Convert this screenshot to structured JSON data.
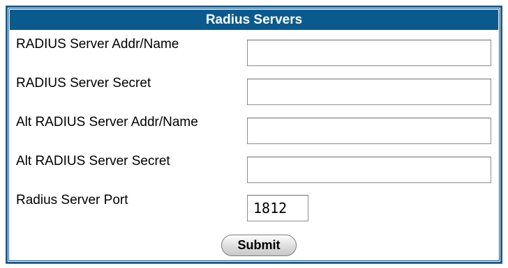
{
  "panel": {
    "title": "Radius Servers",
    "header_color": "#0b5a8e",
    "border_color": "#1f5c8c"
  },
  "form": {
    "fields": [
      {
        "label": "RADIUS Server Addr/Name",
        "value": ""
      },
      {
        "label": "RADIUS Server Secret",
        "value": ""
      },
      {
        "label": "Alt RADIUS Server Addr/Name",
        "value": ""
      },
      {
        "label": "Alt RADIUS Server Secret",
        "value": ""
      },
      {
        "label": "Radius Server Port",
        "value": "1812"
      }
    ],
    "submit_label": "Submit"
  }
}
